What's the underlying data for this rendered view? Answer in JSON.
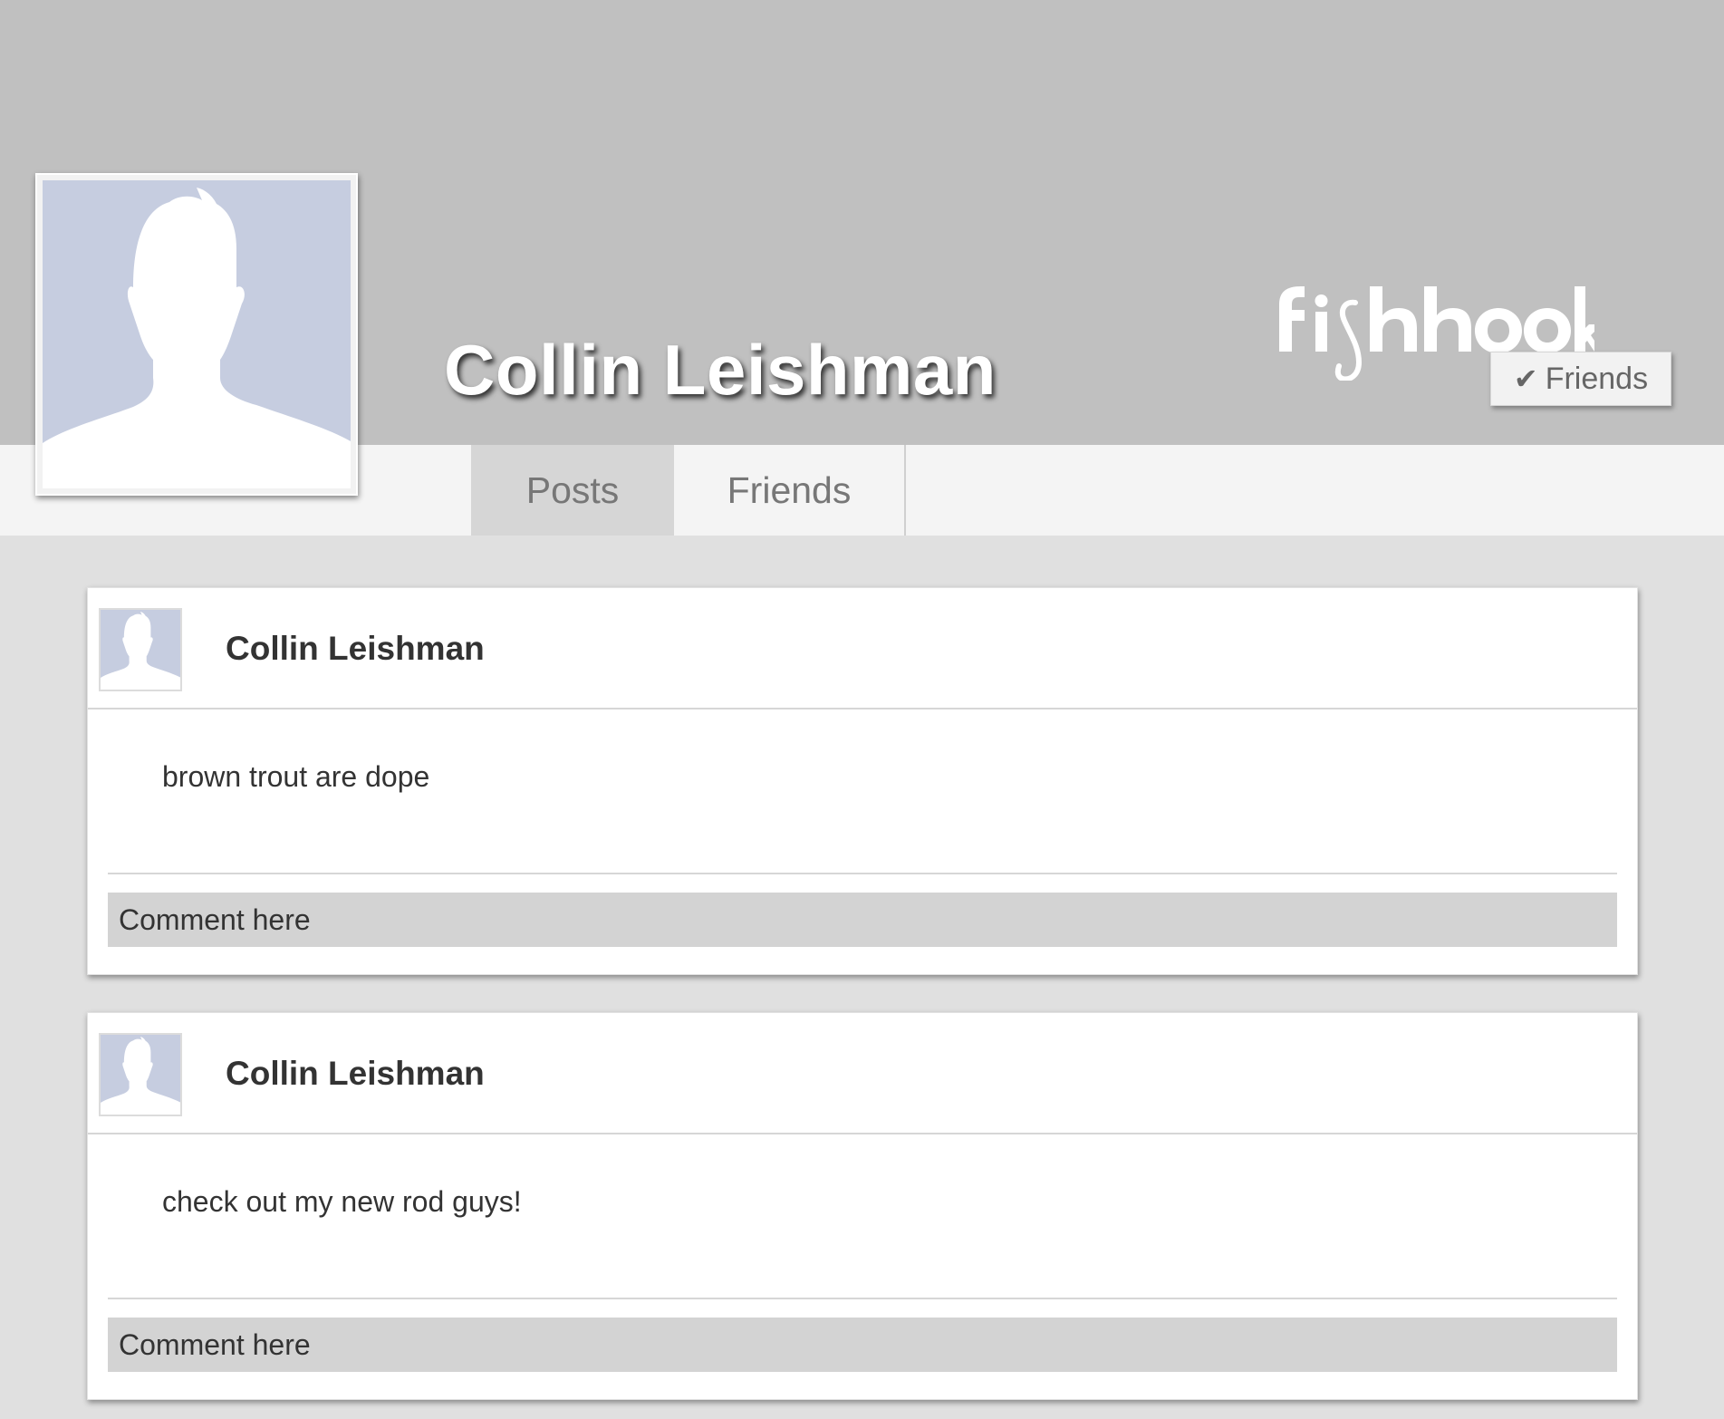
{
  "profile": {
    "name": "Collin Leishman",
    "photo": "default-avatar-silhouette"
  },
  "brand": {
    "logo_text": "fishhook"
  },
  "header": {
    "friends_button": {
      "check_icon": "✔",
      "label": "Friends"
    }
  },
  "tabs": [
    {
      "label": "Posts",
      "active": true
    },
    {
      "label": "Friends",
      "active": false
    }
  ],
  "posts": [
    {
      "author": "Collin Leishman",
      "text": "brown trout are dope",
      "comment_placeholder": "Comment here"
    },
    {
      "author": "Collin Leishman",
      "text": "check out my new rod guys!",
      "comment_placeholder": "Comment here"
    }
  ],
  "colors": {
    "cover": "#c0c0c0",
    "tab_bar": "#f4f4f4",
    "active_tab": "#d6d6d6",
    "page_background": "#e0e0e0",
    "avatar_background": "#c6cde0",
    "comment_field": "#d3d3d3"
  }
}
